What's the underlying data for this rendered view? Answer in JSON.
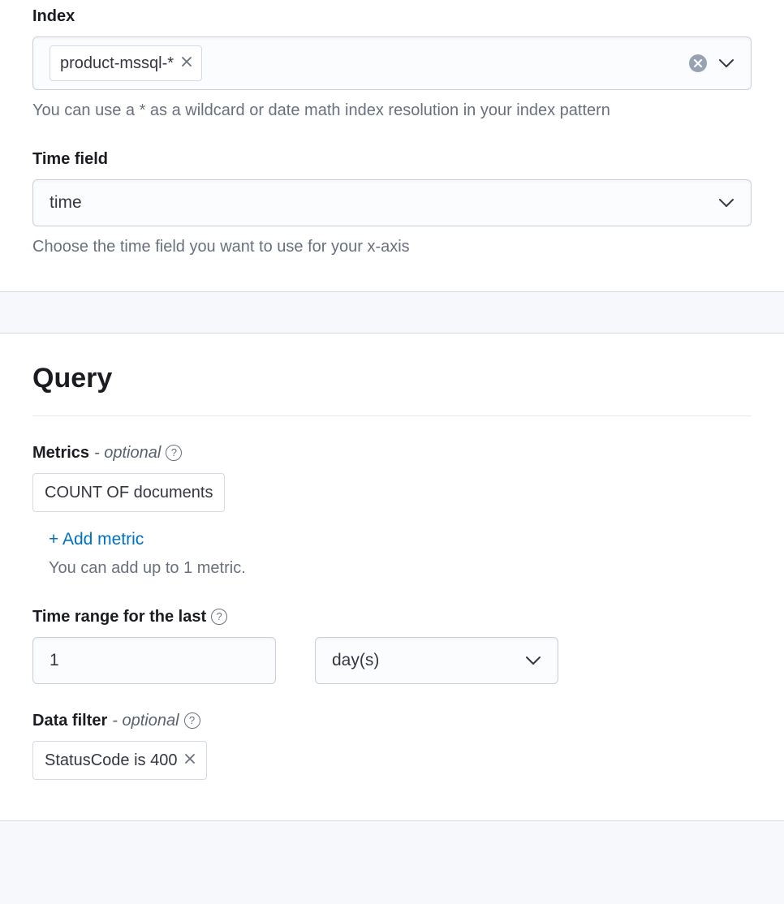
{
  "index": {
    "label": "Index",
    "chip_value": "product-mssql-*",
    "helper": "You can use a * as a wildcard or date math index resolution in your index pattern"
  },
  "time_field": {
    "label": "Time field",
    "value": "time",
    "helper": "Choose the time field you want to use for your x-axis"
  },
  "query": {
    "title": "Query",
    "metrics": {
      "label": "Metrics",
      "optional_text": "- optional",
      "chip_value": "COUNT OF documents",
      "add_link": "+ Add metric",
      "add_help": "You can add up to 1 metric."
    },
    "time_range": {
      "label": "Time range for the last",
      "value": "1",
      "unit": "day(s)"
    },
    "data_filter": {
      "label": "Data filter",
      "optional_text": "- optional",
      "chip_value": "StatusCode is 400"
    }
  }
}
